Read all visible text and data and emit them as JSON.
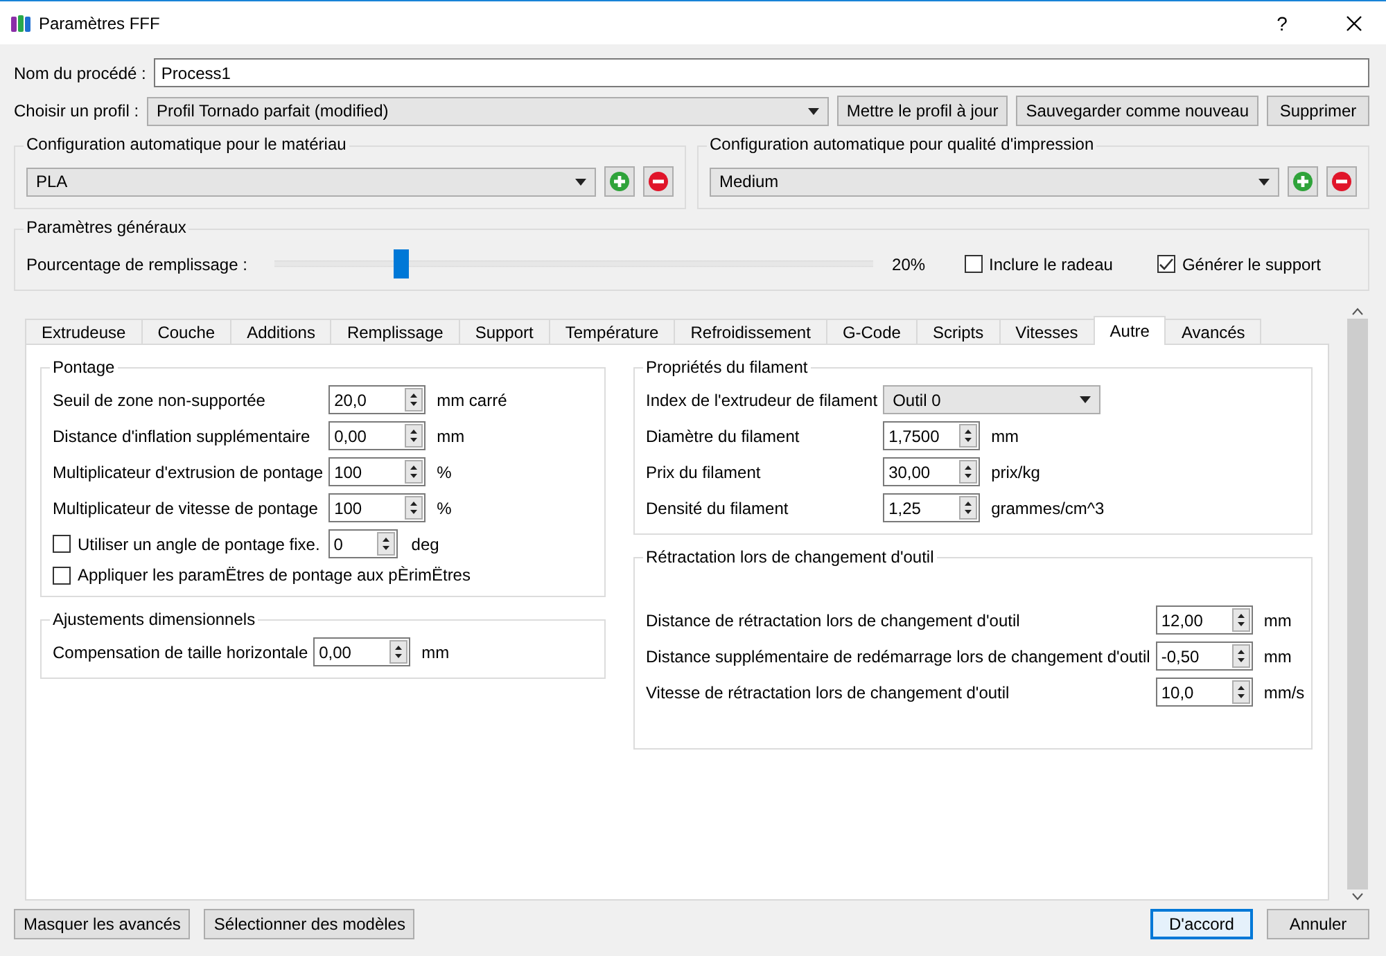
{
  "window": {
    "title": "Paramètres FFF",
    "help": "?"
  },
  "process_name": {
    "label": "Nom du procédé :",
    "value": "Process1"
  },
  "profile": {
    "label": "Choisir un profil :",
    "value": "Profil Tornado parfait (modified)",
    "buttons": [
      "Mettre le profil à jour",
      "Sauvegarder comme nouveau",
      "Supprimer"
    ]
  },
  "auto_config": [
    {
      "title": "Configuration automatique pour le matériau",
      "value": "PLA"
    },
    {
      "title": "Configuration automatique pour qualité d'impression",
      "value": "Medium"
    }
  ],
  "general": {
    "title": "Paramètres généraux",
    "infill": {
      "label": "Pourcentage de remplissage :",
      "level": 0.21,
      "reading": "20%"
    },
    "options": [
      {
        "label": "Inclure le radeau",
        "checked": false
      },
      {
        "label": "Générer le support",
        "checked": true
      }
    ]
  },
  "tabs": [
    {
      "label": "Extrudeuse",
      "selected": false
    },
    {
      "label": "Couche",
      "selected": false
    },
    {
      "label": "Additions",
      "selected": false
    },
    {
      "label": "Remplissage",
      "selected": false
    },
    {
      "label": "Support",
      "selected": false
    },
    {
      "label": "Température",
      "selected": false
    },
    {
      "label": "Refroidissement",
      "selected": false
    },
    {
      "label": "G-Code",
      "selected": false
    },
    {
      "label": "Scripts",
      "selected": false
    },
    {
      "label": "Vitesses",
      "selected": false
    },
    {
      "label": "Autre",
      "selected": true
    },
    {
      "label": "Avancés",
      "selected": false
    }
  ],
  "columns": [
    {
      "groups": [
        {
          "title": "Pontage",
          "rows": [
            {
              "kind": "spin",
              "label": "Seuil de zone non-supportée",
              "value": "20,0",
              "unit": "mm carré"
            },
            {
              "kind": "spin",
              "label": "Distance d'inflation supplémentaire",
              "value": "0,00",
              "unit": "mm"
            },
            {
              "kind": "spin",
              "label": "Multiplicateur d'extrusion de pontage",
              "value": "100",
              "unit": "%"
            },
            {
              "kind": "spin",
              "label": "Multiplicateur de vitesse de pontage",
              "value": "100",
              "unit": "%"
            },
            {
              "kind": "check_spin",
              "label": "Utiliser un angle de pontage fixe.",
              "checked": false,
              "value": "0",
              "unit": "deg"
            },
            {
              "kind": "check",
              "label": "Appliquer les paramËtres de pontage aux pÈrimËtres",
              "checked": false
            }
          ]
        },
        {
          "title": "Ajustements dimensionnels",
          "rows": [
            {
              "kind": "spin",
              "label": "Compensation de taille horizontale",
              "value": "0,00",
              "unit": "mm"
            }
          ]
        }
      ]
    },
    {
      "groups": [
        {
          "title": "Propriétés du filament",
          "rows": [
            {
              "kind": "select",
              "label": "Index de l'extrudeur de filament",
              "value": "Outil 0"
            },
            {
              "kind": "spin",
              "label": "Diamètre du filament",
              "value": "1,7500",
              "unit": "mm"
            },
            {
              "kind": "spin",
              "label": "Prix du filament",
              "value": "30,00",
              "unit": "prix/kg"
            },
            {
              "kind": "spin",
              "label": "Densité du filament",
              "value": "1,25",
              "unit": "grammes/cm^3"
            }
          ]
        },
        {
          "title": "Rétractation lors de changement d'outil",
          "rows": [
            {
              "kind": "spin",
              "label": "Distance de rétractation lors de changement d'outil",
              "value": "12,00",
              "unit": "mm"
            },
            {
              "kind": "spin",
              "label": "Distance supplémentaire de redémarrage lors de changement d'outil",
              "value": "-0,50",
              "unit": "mm"
            },
            {
              "kind": "spin",
              "label": "Vitesse de rétractation lors de changement d'outil",
              "value": "10,0",
              "unit": "mm/s"
            }
          ]
        }
      ]
    }
  ],
  "footer": {
    "left_buttons": [
      "Masquer les avancés",
      "Sélectionner des modèles"
    ],
    "right_buttons": [
      {
        "label": "D'accord",
        "default": true
      },
      {
        "label": "Annuler",
        "default": false
      }
    ]
  }
}
